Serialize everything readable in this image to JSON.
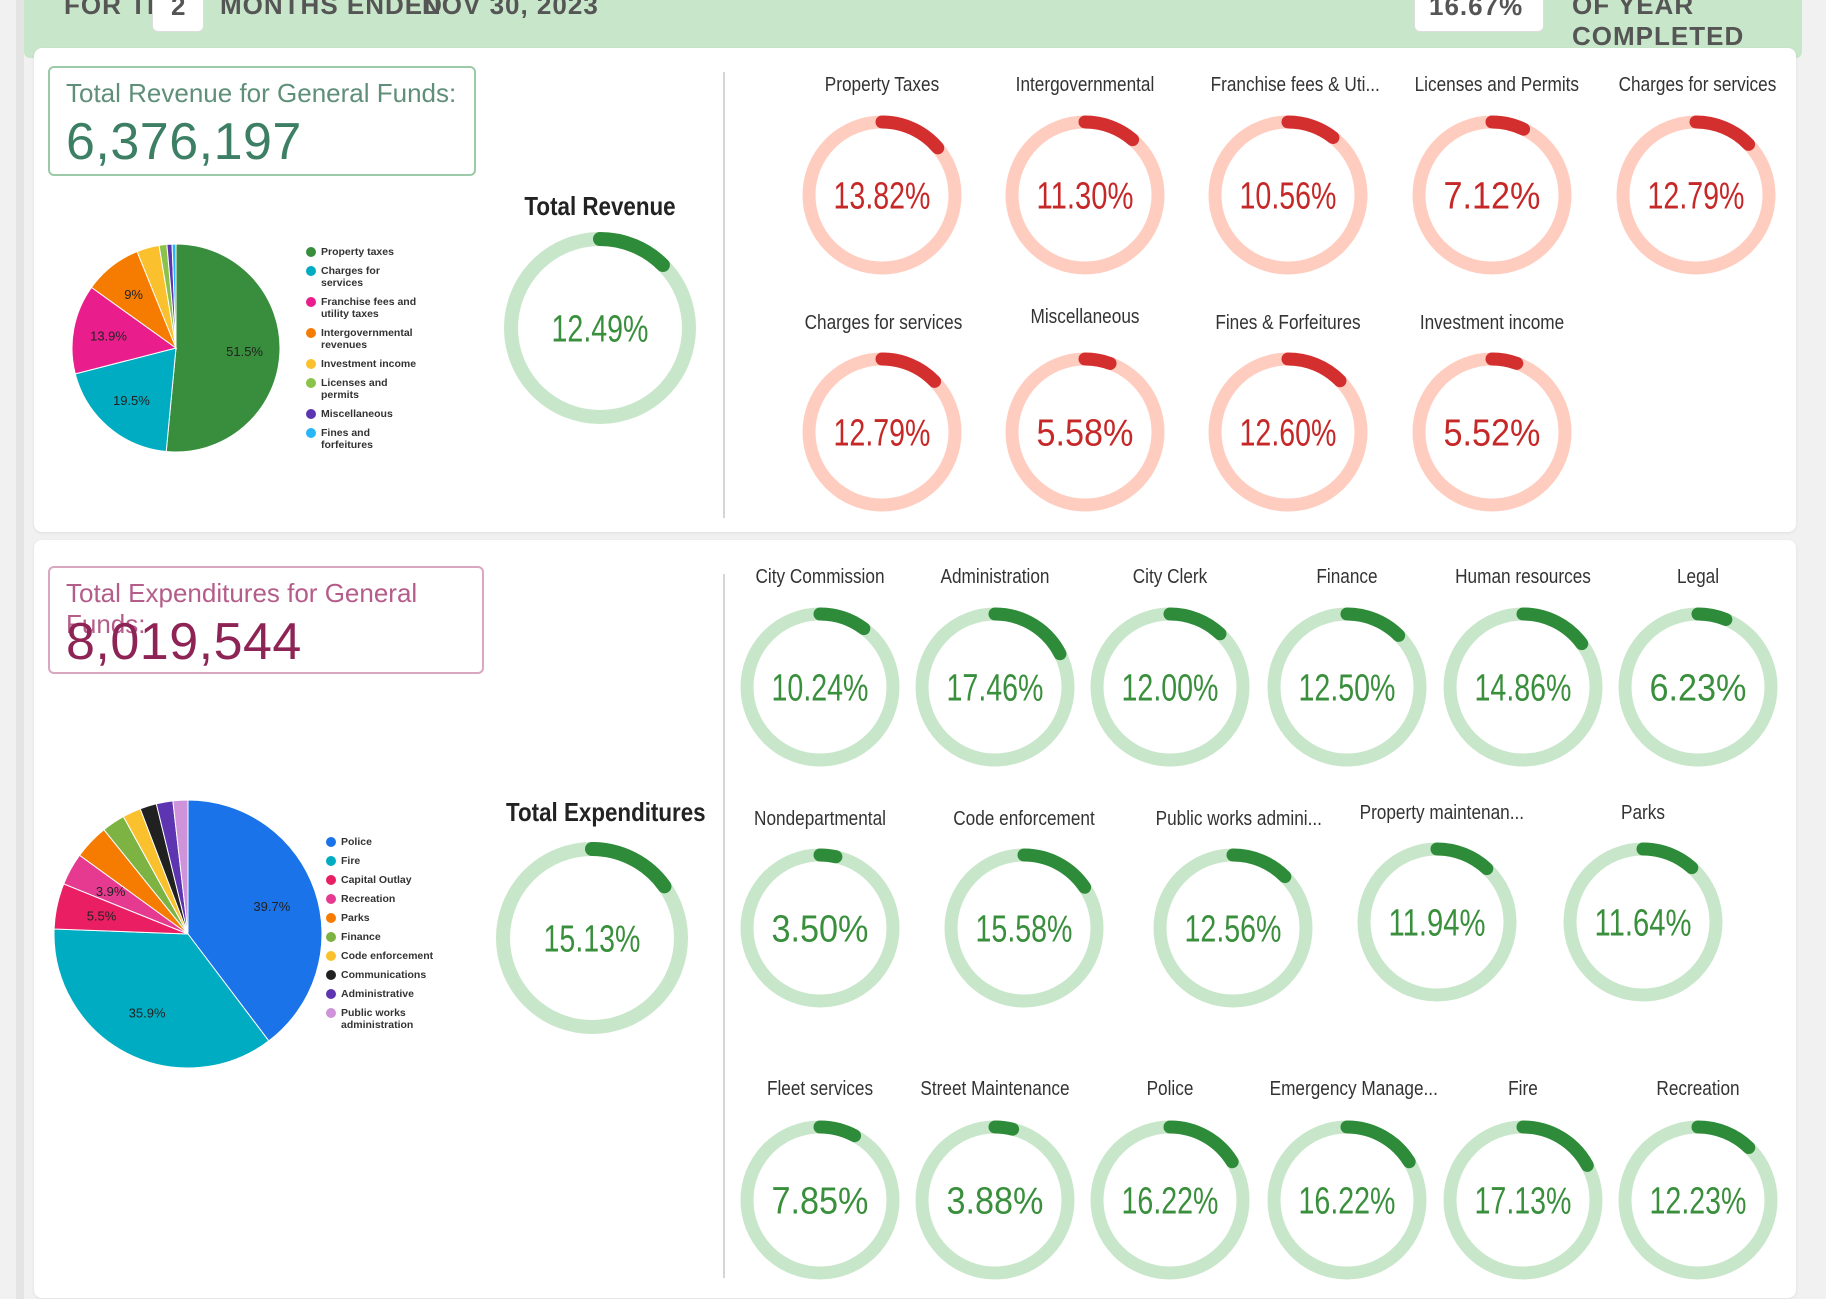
{
  "header": {
    "for_the": "FOR THE",
    "months": "2",
    "months_ended": "MONTHS ENDED",
    "date": "NOV 30, 2023",
    "pct": "16.67%",
    "year_completed": "OF YEAR COMPLETED"
  },
  "colors": {
    "revenue_accent": "#3d7f64",
    "expenditure_accent": "#8e2456",
    "green_fill": "#2e8b3a",
    "green_track": "#c8e6c9",
    "red_fill": "#d32f2f",
    "red_track": "#ffcdbf",
    "green_text": "#3a8f3d",
    "red_text": "#c62828"
  },
  "revenue": {
    "total_label": "Total Revenue for General Funds:",
    "total_value": "6,376,197",
    "gauge_title": "Total Revenue",
    "gauge": {
      "value": 12.49,
      "label": "12.49%"
    },
    "pie": {
      "slices": [
        {
          "name": "Property taxes",
          "pct": 51.5,
          "color": "#388e3c",
          "label": "51.5%"
        },
        {
          "name": "Charges for services",
          "pct": 19.5,
          "color": "#00acc1",
          "label": "19.5%"
        },
        {
          "name": "Franchise fees and utility taxes",
          "pct": 13.9,
          "color": "#e91e8c",
          "label": "13.9%"
        },
        {
          "name": "Intergovernmental revenues",
          "pct": 9.0,
          "color": "#f57c00",
          "label": "9%"
        },
        {
          "name": "Investment income",
          "pct": 3.5,
          "color": "#fbc02d",
          "label": ""
        },
        {
          "name": "Licenses and permits",
          "pct": 1.2,
          "color": "#8bc34a",
          "label": ""
        },
        {
          "name": "Miscellaneous",
          "pct": 0.8,
          "color": "#5e35b1",
          "label": ""
        },
        {
          "name": "Fines and forfeitures",
          "pct": 0.6,
          "color": "#29b6f6",
          "label": ""
        }
      ]
    },
    "legend": [
      "Property taxes",
      "Charges for services",
      "Franchise fees and utility taxes",
      "Intergovernmental revenues",
      "Investment income",
      "Licenses and permits",
      "Miscellaneous",
      "Fines and forfeitures"
    ],
    "legend_colors": [
      "#388e3c",
      "#00acc1",
      "#e91e8c",
      "#f57c00",
      "#fbc02d",
      "#8bc34a",
      "#5e35b1",
      "#29b6f6"
    ],
    "gauges": [
      {
        "title": "Property Taxes",
        "value": 13.82,
        "label": "13.82%"
      },
      {
        "title": "Intergovernmental",
        "value": 11.3,
        "label": "11.30%"
      },
      {
        "title": "Franchise fees & Uti...",
        "value": 10.56,
        "label": "10.56%"
      },
      {
        "title": "Licenses and Permits",
        "value": 7.12,
        "label": "7.12%"
      },
      {
        "title": "Charges for services",
        "value": 12.79,
        "label": "12.79%"
      },
      {
        "title": "Charges for services",
        "value": 12.79,
        "label": "12.79%"
      },
      {
        "title": "Miscellaneous",
        "value": 5.58,
        "label": "5.58%"
      },
      {
        "title": "Fines & Forfeitures",
        "value": 12.6,
        "label": "12.60%"
      },
      {
        "title": "Investment income",
        "value": 5.52,
        "label": "5.52%"
      }
    ]
  },
  "expenditures": {
    "total_label": "Total Expenditures for General Funds:",
    "total_value": "8,019,544",
    "gauge_title": "Total Expenditures",
    "gauge": {
      "value": 15.13,
      "label": "15.13%"
    },
    "pie": {
      "slices": [
        {
          "name": "Police",
          "pct": 39.7,
          "color": "#1a73e8",
          "label": "39.7%"
        },
        {
          "name": "Fire",
          "pct": 35.9,
          "color": "#00acc1",
          "label": "35.9%"
        },
        {
          "name": "Capital Outlay",
          "pct": 5.5,
          "color": "#e91e63",
          "label": "5.5%"
        },
        {
          "name": "Recreation",
          "pct": 3.9,
          "color": "#e53a8f",
          "label": "3.9%"
        },
        {
          "name": "Parks",
          "pct": 4.2,
          "color": "#f57c00",
          "label": ""
        },
        {
          "name": "Finance",
          "pct": 2.8,
          "color": "#7cb342",
          "label": ""
        },
        {
          "name": "Code enforcement",
          "pct": 2.2,
          "color": "#fbc02d",
          "label": ""
        },
        {
          "name": "Communications",
          "pct": 2.0,
          "color": "#212121",
          "label": ""
        },
        {
          "name": "Administrative",
          "pct": 2.0,
          "color": "#5e35b1",
          "label": ""
        },
        {
          "name": "Public works administration",
          "pct": 1.8,
          "color": "#ce93d8",
          "label": ""
        }
      ]
    },
    "legend": [
      "Police",
      "Fire",
      "Capital Outlay",
      "Recreation",
      "Parks",
      "Finance",
      "Code enforcement",
      "Communications",
      "Administrative",
      "Public works administration"
    ],
    "legend_colors": [
      "#1a73e8",
      "#00acc1",
      "#e91e63",
      "#e53a8f",
      "#f57c00",
      "#7cb342",
      "#fbc02d",
      "#212121",
      "#5e35b1",
      "#ce93d8"
    ],
    "gauges": [
      {
        "title": "City Commission",
        "value": 10.24,
        "label": "10.24%"
      },
      {
        "title": "Administration",
        "value": 17.46,
        "label": "17.46%"
      },
      {
        "title": "City Clerk",
        "value": 12.0,
        "label": "12.00%"
      },
      {
        "title": "Finance",
        "value": 12.5,
        "label": "12.50%"
      },
      {
        "title": "Human resources",
        "value": 14.86,
        "label": "14.86%"
      },
      {
        "title": "Legal",
        "value": 6.23,
        "label": "6.23%"
      },
      {
        "title": "Nondepartmental",
        "value": 3.5,
        "label": "3.50%"
      },
      {
        "title": "Code enforcement",
        "value": 15.58,
        "label": "15.58%"
      },
      {
        "title": "Public works admini...",
        "value": 12.56,
        "label": "12.56%"
      },
      {
        "title": "Property maintenan...",
        "value": 11.94,
        "label": "11.94%"
      },
      {
        "title": "Parks",
        "value": 11.64,
        "label": "11.64%"
      },
      {
        "title": "Fleet services",
        "value": 7.85,
        "label": "7.85%"
      },
      {
        "title": "Street Maintenance",
        "value": 3.88,
        "label": "3.88%"
      },
      {
        "title": "Police",
        "value": 16.22,
        "label": "16.22%"
      },
      {
        "title": "Emergency Manage...",
        "value": 16.22,
        "label": "16.22%"
      },
      {
        "title": "Fire",
        "value": 17.13,
        "label": "17.13%"
      },
      {
        "title": "Recreation",
        "value": 12.23,
        "label": "12.23%"
      }
    ]
  }
}
